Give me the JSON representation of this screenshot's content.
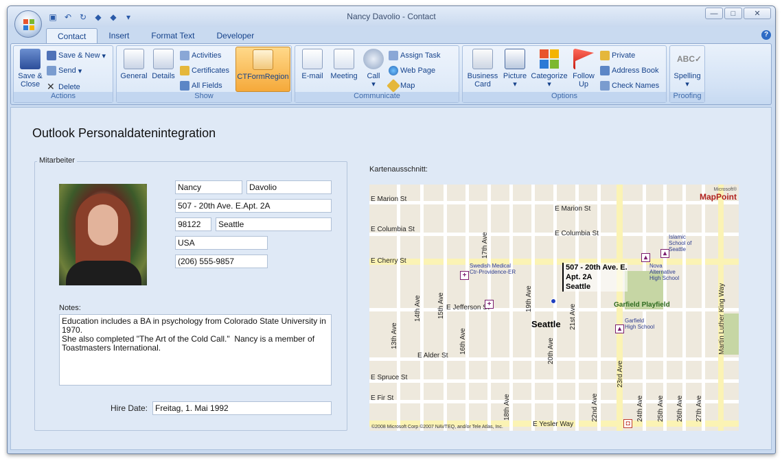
{
  "window": {
    "title": "Nancy Davolio - Contact",
    "controls": {
      "minimize": "—",
      "maximize": "□",
      "close": "✕"
    }
  },
  "quick_access": [
    "save-icon",
    "undo-icon",
    "redo-icon",
    "up-arrow-icon",
    "down-arrow-icon",
    "customize-icon"
  ],
  "tabs": [
    {
      "label": "Contact",
      "active": true
    },
    {
      "label": "Insert"
    },
    {
      "label": "Format Text"
    },
    {
      "label": "Developer"
    }
  ],
  "ribbon": {
    "actions": {
      "label": "Actions",
      "save_close": "Save &\nClose",
      "save_new": "Save & New",
      "send": "Send",
      "delete": "Delete"
    },
    "show": {
      "label": "Show",
      "general": "General",
      "details": "Details",
      "activities": "Activities",
      "certificates": "Certificates",
      "all_fields": "All Fields",
      "region": "CTFormRegion"
    },
    "communicate": {
      "label": "Communicate",
      "email": "E-mail",
      "meeting": "Meeting",
      "call": "Call",
      "assign_task": "Assign Task",
      "web_page": "Web Page",
      "map": "Map"
    },
    "options": {
      "label": "Options",
      "business_card": "Business\nCard",
      "picture": "Picture",
      "categorize": "Categorize",
      "follow_up": "Follow\nUp",
      "private": "Private",
      "address_book": "Address Book",
      "check_names": "Check Names"
    },
    "proofing": {
      "label": "Proofing",
      "spelling": "Spelling"
    }
  },
  "form": {
    "title": "Outlook Personaldatenintegration",
    "group_label": "Mitarbeiter",
    "first_name": "Nancy",
    "last_name": "Davolio",
    "street": "507 - 20th Ave. E.Apt. 2A",
    "zip": "98122",
    "city": "Seattle",
    "country": "USA",
    "phone": "(206) 555-9857",
    "notes_label": "Notes:",
    "notes": "Education includes a BA in psychology from Colorado State University in 1970.\nShe also completed \"The Art of the Cold Call.\"  Nancy is a member of\nToastmasters International.",
    "hire_label": "Hire Date:",
    "hire_date": "Freitag, 1. Mai 1992"
  },
  "map": {
    "label": "Kartenausschnitt:",
    "brand_small": "Microsoft®",
    "brand": "MapPoint",
    "address_line1": "507 - 20th Ave. E.",
    "address_line2": "Apt. 2A",
    "address_line3": "Seattle",
    "city": "Seattle",
    "streets": {
      "marion_w": "E  Marion  St",
      "marion_e": "E  Marion  St",
      "columbia_w": "E  Columbia  St",
      "columbia_e": "E  Columbia  St",
      "cherry": "E  Cherry  St",
      "jefferson": "E  Jefferson  St",
      "alder": "E  Alder  St",
      "spruce": "E  Spruce  St",
      "fir": "E  Fir  St",
      "yesler": "E  Yesler  Way",
      "ave13": "13th  Ave",
      "ave14": "14th  Ave",
      "ave15": "15th  Ave",
      "ave16": "16th  Ave",
      "ave17": "17th  Ave",
      "ave18": "18th  Ave",
      "ave19": "19th  Ave",
      "ave20": "20th  Ave",
      "ave21": "21st  Ave",
      "ave22": "22nd  Ave",
      "ave23": "23rd  Ave",
      "ave24": "24th  Ave",
      "ave25": "25th  Ave",
      "ave26": "26th  Ave",
      "ave27": "27th  Ave",
      "mlk": "Martin  Luther  King  Way"
    },
    "poi": {
      "swedish": "Swedish Medical\nCtr-Providence-ER",
      "islamic": "Islamic\nSchool of\nSeattle",
      "nova": "Nova\nAlternative\nHigh School",
      "garfield_park": "Garfield Playfield",
      "garfield_hs": "Garfield\nHigh School"
    },
    "copyright": "©2008 Microsoft Corp ©2007 NAVTEQ, and/or Tele Atlas, Inc."
  }
}
